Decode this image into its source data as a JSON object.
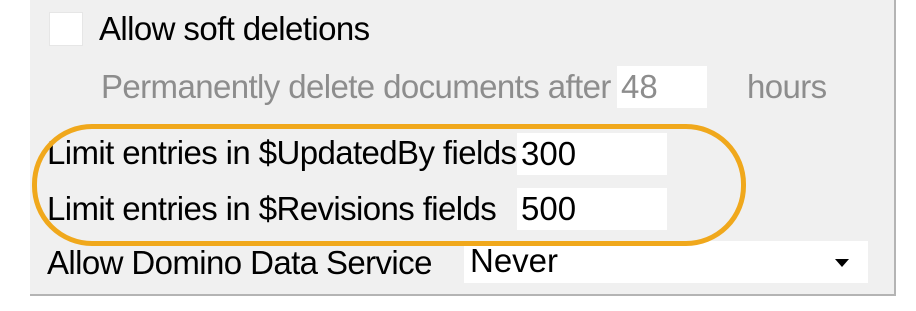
{
  "options": {
    "allow_soft_deletions": {
      "label": "Allow soft deletions",
      "checked": false
    },
    "permanently_delete": {
      "label": "Permanently delete documents after",
      "value": "48",
      "unit": "hours"
    },
    "limit_updatedby": {
      "label": "Limit entries in $UpdatedBy fields",
      "value": "300"
    },
    "limit_revisions": {
      "label": "Limit entries in $Revisions fields",
      "value": "500"
    },
    "domino_data_service": {
      "label": "Allow Domino Data Service",
      "value": "Never"
    }
  },
  "colors": {
    "highlight": "#f0a81c",
    "panel_background": "#f0f0f0",
    "disabled_text": "#8d8d8d"
  },
  "icons": {
    "dropdown": "triangle-down"
  }
}
